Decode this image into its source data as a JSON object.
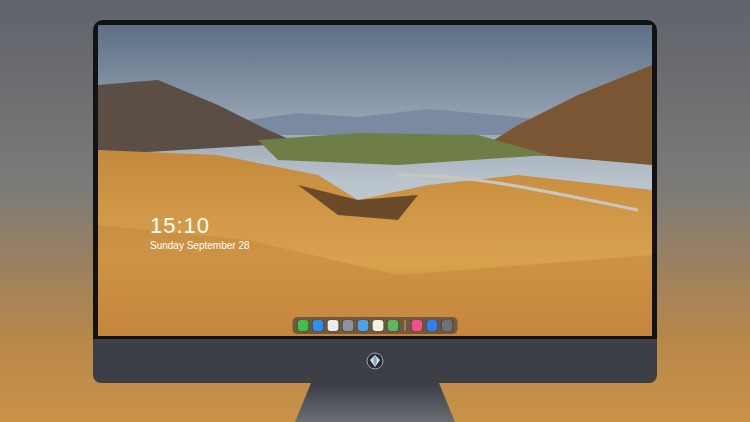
{
  "clock": {
    "time": "15:10",
    "date": "Sunday September 28"
  },
  "dock": {
    "apps": [
      {
        "color": "#3fbf4a"
      },
      {
        "color": "#2f8ef0"
      },
      {
        "color": "#e9eef3"
      },
      {
        "color": "#8c939c"
      },
      {
        "color": "#4aa3e8"
      },
      {
        "color": "#f4f1e4"
      },
      {
        "color": "#5db85f"
      }
    ],
    "extras": [
      {
        "color": "#f0508a"
      },
      {
        "color": "#2f7ff0"
      },
      {
        "color": "#6e7379"
      }
    ]
  }
}
